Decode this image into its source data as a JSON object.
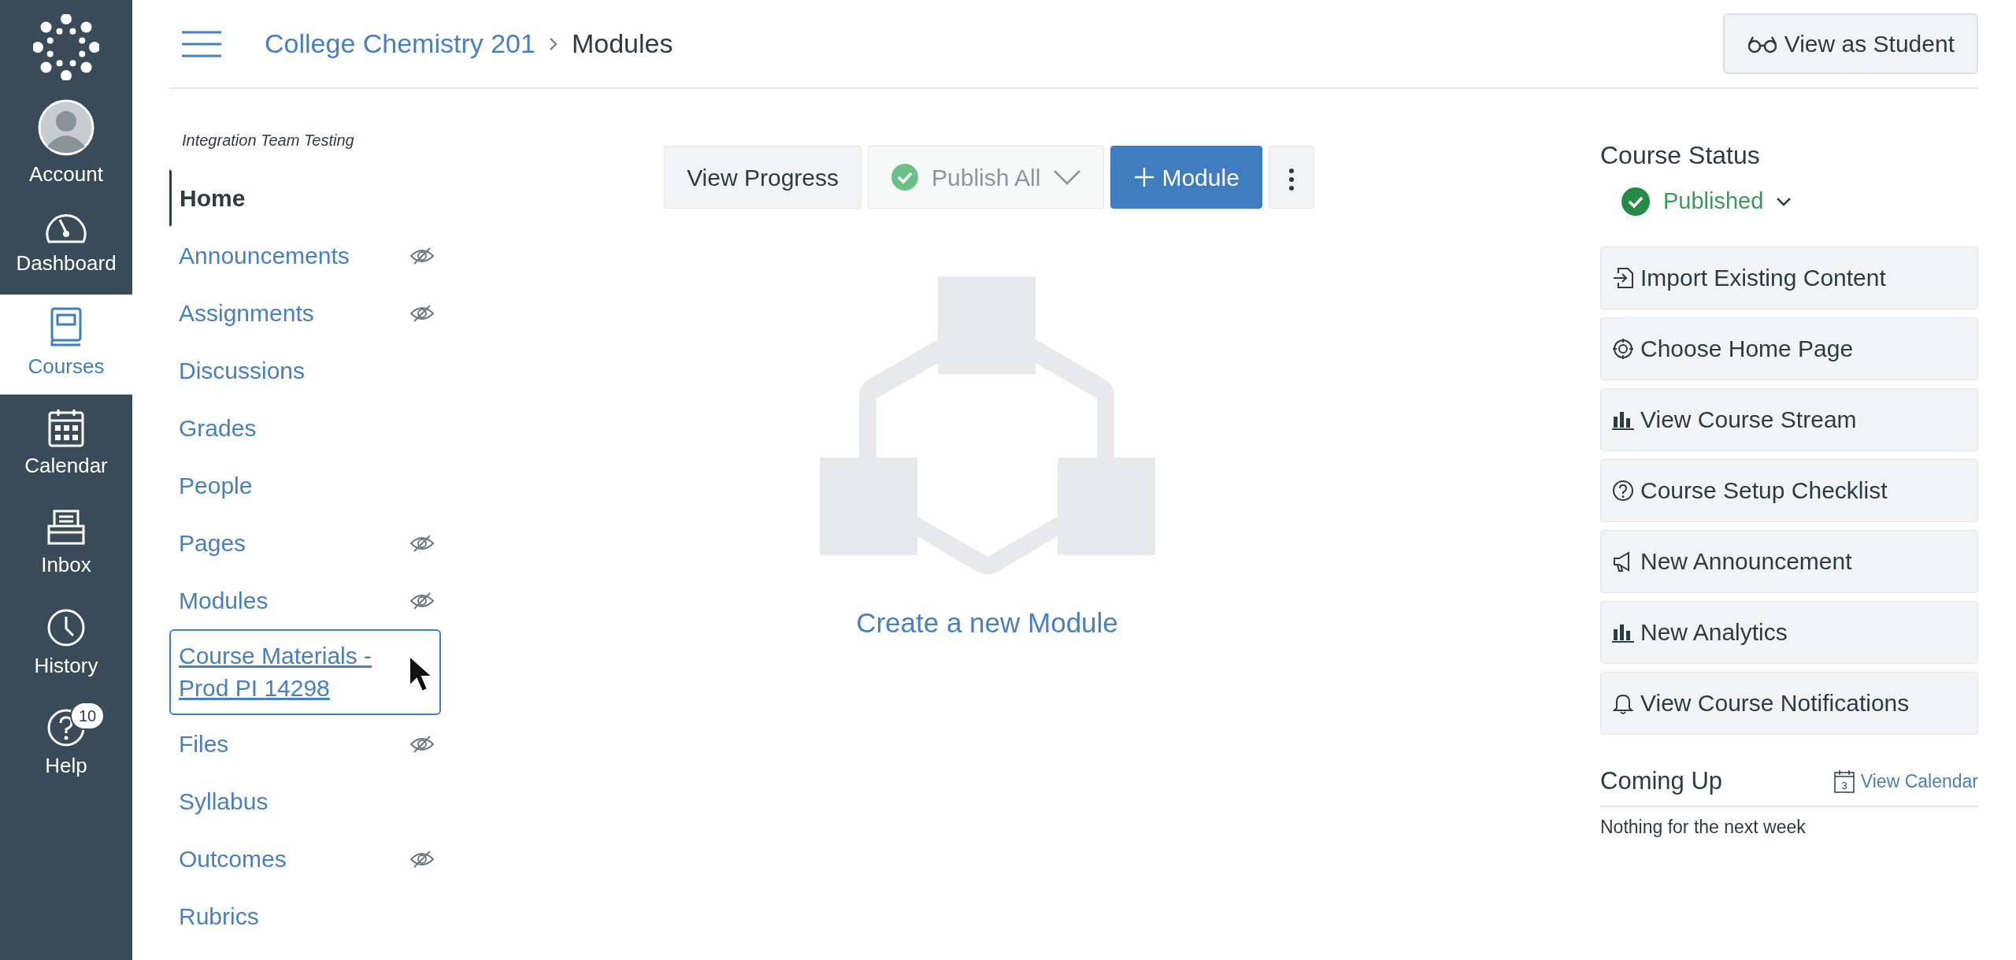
{
  "global_nav": {
    "items": [
      {
        "label": "Account",
        "selected": false
      },
      {
        "label": "Dashboard",
        "selected": false
      },
      {
        "label": "Courses",
        "selected": true
      },
      {
        "label": "Calendar",
        "selected": false
      },
      {
        "label": "Inbox",
        "selected": false
      },
      {
        "label": "History",
        "selected": false
      },
      {
        "label": "Help",
        "selected": false,
        "badge": "10"
      }
    ]
  },
  "breadcrumb": [
    "College Chemistry 201",
    "Modules"
  ],
  "view_as_student": "View as Student",
  "course_nav": {
    "subtitle": "Integration Team Testing",
    "items": [
      {
        "label": "Home",
        "selected": true,
        "hidden": false,
        "focused": false
      },
      {
        "label": "Announcements",
        "selected": false,
        "hidden": true,
        "focused": false
      },
      {
        "label": "Assignments",
        "selected": false,
        "hidden": true,
        "focused": false
      },
      {
        "label": "Discussions",
        "selected": false,
        "hidden": false,
        "focused": false
      },
      {
        "label": "Grades",
        "selected": false,
        "hidden": false,
        "focused": false
      },
      {
        "label": "People",
        "selected": false,
        "hidden": false,
        "focused": false
      },
      {
        "label": "Pages",
        "selected": false,
        "hidden": true,
        "focused": false
      },
      {
        "label": "Modules",
        "selected": false,
        "hidden": true,
        "focused": false
      },
      {
        "label": "Course Materials - Prod PI 14298",
        "selected": false,
        "hidden": false,
        "focused": true
      },
      {
        "label": "Files",
        "selected": false,
        "hidden": true,
        "focused": false
      },
      {
        "label": "Syllabus",
        "selected": false,
        "hidden": false,
        "focused": false
      },
      {
        "label": "Outcomes",
        "selected": false,
        "hidden": true,
        "focused": false
      },
      {
        "label": "Rubrics",
        "selected": false,
        "hidden": false,
        "focused": false
      }
    ]
  },
  "toolbar": {
    "view_progress": "View Progress",
    "publish_all": {
      "label": "Publish All",
      "disabled": true
    },
    "add_module": "Module"
  },
  "empty_state": {
    "link": "Create a new Module"
  },
  "course_status": {
    "title": "Course Status",
    "status": "Published",
    "published": true
  },
  "actions": [
    "Import Existing Content",
    "Choose Home Page",
    "View Course Stream",
    "Course Setup Checklist",
    "New Announcement",
    "New Analytics",
    "View Course Notifications"
  ],
  "coming_up": {
    "title": "Coming Up",
    "calendar_day": "3",
    "link": "View Calendar",
    "empty": "Nothing for the next week"
  }
}
